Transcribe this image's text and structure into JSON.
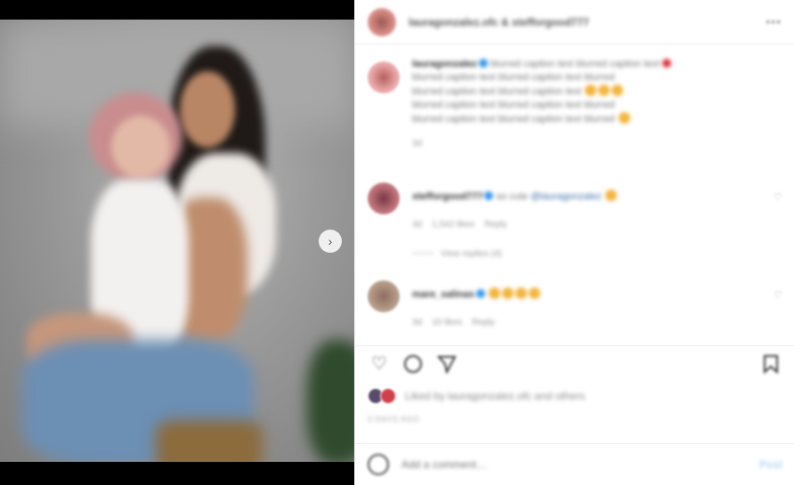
{
  "post": {
    "header_username": "lauragonzalez.ofc & stefforgood777",
    "more_icon": "ellipsis-icon"
  },
  "comments": [
    {
      "username": "lauragonzalez",
      "lines": [
        "blurred caption text blurred caption text",
        "blurred caption text blurred caption text blurred",
        "blurred caption text blurred caption text",
        "blurred caption text blurred caption text blurred",
        "blurred caption text blurred caption text blurred"
      ],
      "meta": "3d"
    },
    {
      "username": "stefforgood777",
      "text": "so cute",
      "mention": "@lauragonzalez",
      "meta_time": "3d",
      "meta_likes": "1,542 likes",
      "meta_reply": "Reply",
      "view_replies": "View replies (4)"
    },
    {
      "username": "mare_salinas",
      "meta_time": "3d",
      "meta_likes": "10 likes",
      "meta_reply": "Reply"
    }
  ],
  "actions": {
    "like_icon": "heart-icon",
    "comment_icon": "comment-icon",
    "share_icon": "share-icon",
    "save_icon": "bookmark-icon"
  },
  "likes_text": "Liked by lauragonzalez.ofc and others",
  "time_ago": "3 DAYS AGO",
  "add_comment": {
    "placeholder": "Add a comment…",
    "post_label": "Post"
  },
  "colors": {
    "link": "#3897f0",
    "border": "#efefef",
    "muted": "#8e8e8e"
  }
}
